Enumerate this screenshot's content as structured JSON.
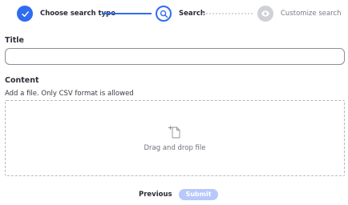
{
  "stepper": {
    "steps": [
      {
        "label": "Choose search type",
        "state": "completed",
        "icon": "check-icon"
      },
      {
        "label": "Search",
        "state": "active",
        "icon": "search-icon"
      },
      {
        "label": "Customize search",
        "state": "upcoming",
        "icon": "eye-icon"
      }
    ],
    "colors": {
      "active": "#2f6cf0",
      "inactive": "#cfd1d6"
    }
  },
  "form": {
    "title_label": "Title",
    "title_value": "",
    "content_label": "Content",
    "helper_text": "Add a file. Only CSV format is allowed",
    "dropzone_text": "Drag and drop file",
    "dropzone_icon": "file-add-icon"
  },
  "footer": {
    "previous_label": "Previous",
    "submit_label": "Submit",
    "submit_color": "#b7c9fb"
  }
}
